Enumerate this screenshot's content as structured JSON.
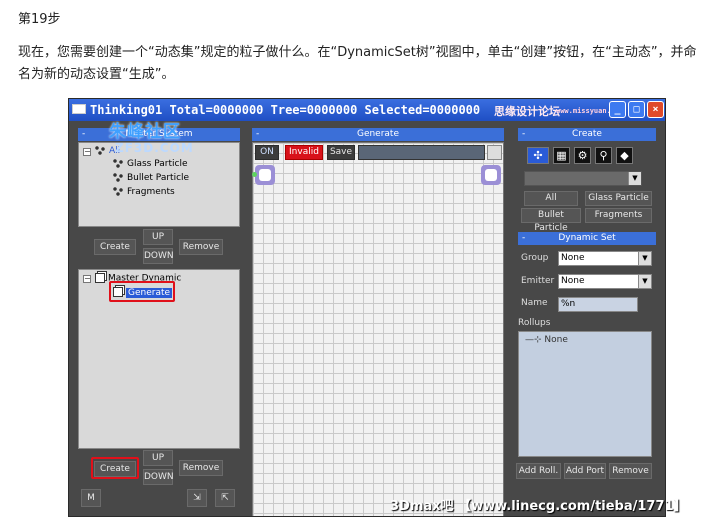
{
  "doc": {
    "step": "第19步",
    "paragraph": "现在，您需要创建一个“动态集”规定的粒子做什么。在“DynamicSet树”视图中，单击“创建”按钮，在“主动态”，并命名为新的动态设置“生成”。"
  },
  "window": {
    "title": "Thinking01  Total=0000000  Tree=0000000  Selected=0000000",
    "watermark": "思缘设计论坛",
    "watermark_url": "www.missyuan.com",
    "buttons": [
      "_",
      "□",
      "×"
    ]
  },
  "overlay": {
    "logo": "朱峰社区",
    "url": "ZF3D.COM"
  },
  "master_system": {
    "header": "Master System",
    "tree": {
      "root": "All",
      "children": [
        "Glass Particle",
        "Bullet Particle",
        "Fragments"
      ]
    },
    "buttons": {
      "create": "Create",
      "up": "UP",
      "down": "DOWN",
      "remove": "Remove"
    }
  },
  "master_dynamic": {
    "tree": {
      "root": "Master Dynamic",
      "child": "Generate"
    },
    "buttons": {
      "create": "Create",
      "up": "UP",
      "down": "DOWN",
      "remove": "Remove",
      "m": "M"
    }
  },
  "generate": {
    "header": "Generate",
    "toolbar": {
      "on": "ON",
      "invalid": "Invalid",
      "save": "Save"
    }
  },
  "create_panel": {
    "header": "Create",
    "buttons": [
      "All",
      "Glass Particle",
      "Bullet Particle",
      "Fragments"
    ]
  },
  "dynamic_set": {
    "header": "Dynamic Set",
    "group_label": "Group",
    "group_value": "None",
    "emitter_label": "Emitter",
    "emitter_value": "None",
    "name_label": "Name",
    "name_value": "%n",
    "rollups_label": "Rollups",
    "rollups_item": "None",
    "buttons": {
      "add_roll": "Add Roll.",
      "add_port": "Add Port",
      "remove": "Remove"
    }
  },
  "bottom_watermark": "3Dmax吧 【www.linecg.com/tieba/1771】"
}
